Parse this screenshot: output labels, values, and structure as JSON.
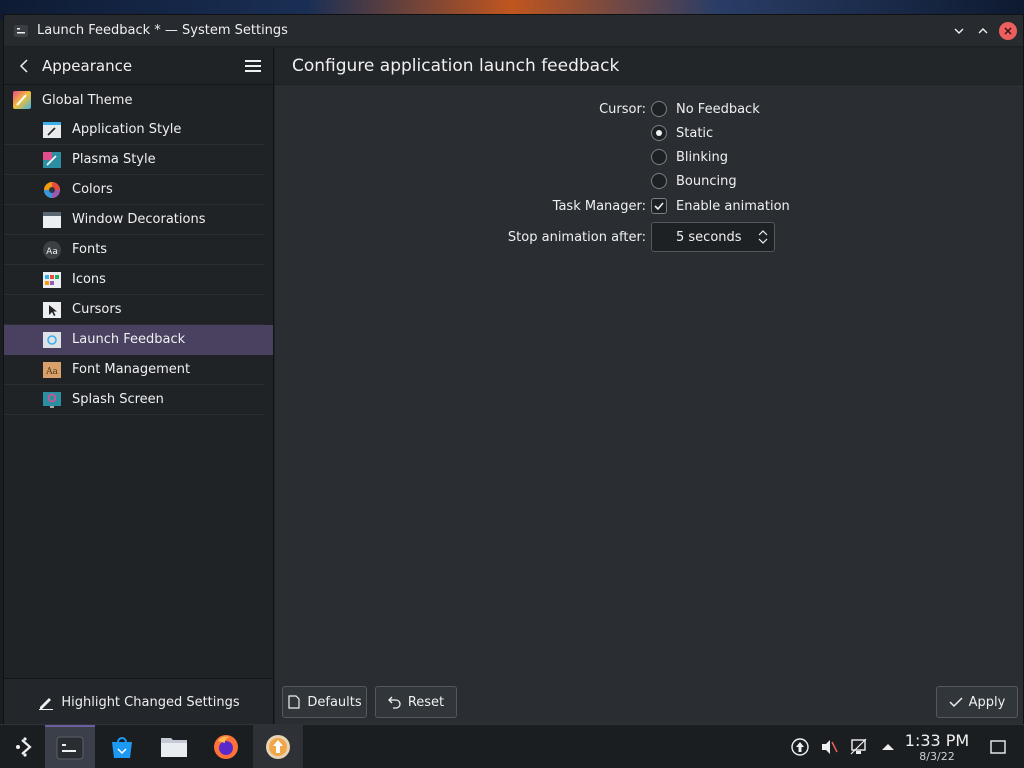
{
  "window": {
    "title": "Launch Feedback * — System Settings"
  },
  "sidebar": {
    "header_label": "Appearance",
    "items": [
      {
        "label": "Global Theme",
        "icon": "global-theme-icon"
      },
      {
        "label": "Application Style",
        "icon": "application-style-icon"
      },
      {
        "label": "Plasma Style",
        "icon": "plasma-style-icon"
      },
      {
        "label": "Colors",
        "icon": "colors-icon"
      },
      {
        "label": "Window Decorations",
        "icon": "window-decorations-icon"
      },
      {
        "label": "Fonts",
        "icon": "fonts-icon"
      },
      {
        "label": "Icons",
        "icon": "icons-icon"
      },
      {
        "label": "Cursors",
        "icon": "cursors-icon"
      },
      {
        "label": "Launch Feedback",
        "icon": "launch-feedback-icon",
        "active": true
      },
      {
        "label": "Font Management",
        "icon": "font-management-icon"
      },
      {
        "label": "Splash Screen",
        "icon": "splash-screen-icon"
      }
    ],
    "footer_label": "Highlight Changed Settings"
  },
  "main": {
    "page_title": "Configure application launch feedback",
    "cursor_label": "Cursor:",
    "cursor_options": [
      {
        "label": "No Feedback",
        "selected": false
      },
      {
        "label": "Static",
        "selected": true
      },
      {
        "label": "Blinking",
        "selected": false
      },
      {
        "label": "Bouncing",
        "selected": false
      }
    ],
    "task_manager_label": "Task Manager:",
    "enable_animation_label": "Enable animation",
    "enable_animation_checked": true,
    "stop_animation_label": "Stop animation after:",
    "stop_animation_value": "5 seconds",
    "buttons": {
      "defaults": "Defaults",
      "reset": "Reset",
      "apply": "Apply"
    }
  },
  "taskbar": {
    "clock_time": "1:33 PM",
    "clock_date": "8/3/22"
  },
  "colors": {
    "accent": "#6b5fa0",
    "active_item_bg": "#4a4060",
    "close_button": "#ed5f5f"
  }
}
